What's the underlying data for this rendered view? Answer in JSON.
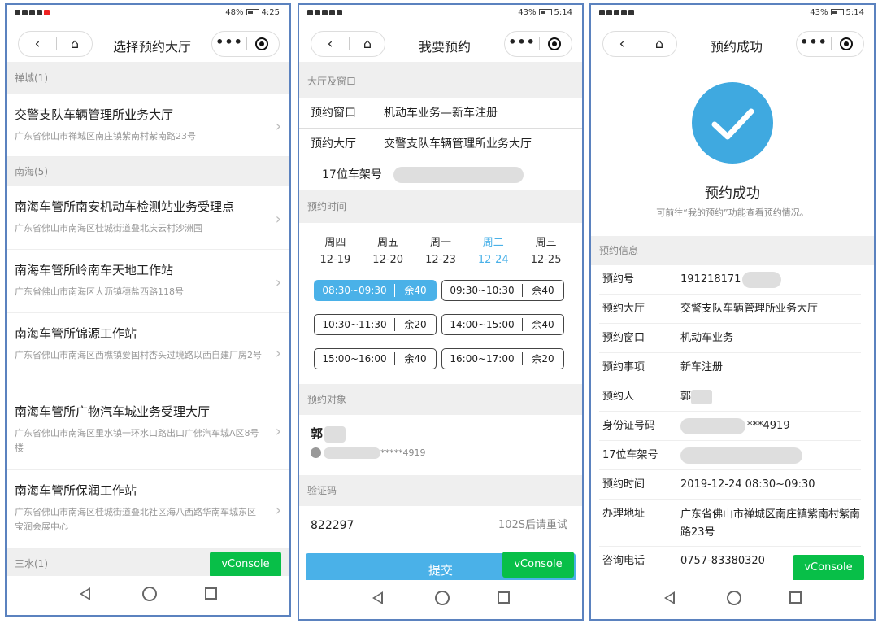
{
  "status": {
    "p1": {
      "battery": "48%",
      "time": "4:25"
    },
    "p2": {
      "battery": "43%",
      "time": "5:14"
    },
    "p3": {
      "battery": "43%",
      "time": "5:14"
    }
  },
  "nav": {
    "back_icon": "‹",
    "home_icon": "⌂",
    "more_icon": "•••",
    "p1_title": "选择预约大厅",
    "p2_title": "我要预约",
    "p3_title": "预约成功"
  },
  "vconsole_label": "vConsole",
  "halls": {
    "groups": [
      {
        "header": "禅城(1)",
        "items": [
          {
            "name": "交警支队车辆管理所业务大厅",
            "addr": "广东省佛山市禅城区南庄镇紫南村紫南路23号"
          }
        ]
      },
      {
        "header": "南海(5)",
        "items": [
          {
            "name": "南海车管所南安机动车检测站业务受理点",
            "addr": "广东省佛山市南海区桂城街道叠北庆云村沙洲围"
          },
          {
            "name": "南海车管所岭南车天地工作站",
            "addr": "广东省佛山市南海区大沥镇穗盐西路118号"
          },
          {
            "name": "南海车管所锦源工作站",
            "addr": "广东省佛山市南海区西樵镇爱国村杏头过境路以西自建厂房2号"
          },
          {
            "name": "南海车管所广物汽车城业务受理大厅",
            "addr": "广东省佛山市南海区里水镇一环水口路出口广佛汽车城A区8号楼"
          },
          {
            "name": "南海车管所保润工作站",
            "addr": "广东省佛山市南海区桂城街道叠北社区海八西路华南车城东区宝润会展中心"
          }
        ]
      },
      {
        "header": "三水(1)",
        "items": []
      }
    ]
  },
  "booking": {
    "section_hall": "大厅及窗口",
    "window_label": "预约窗口",
    "window_value": "机动车业务—新车注册",
    "hall_label": "预约大厅",
    "hall_value": "交警支队车辆管理所业务大厅",
    "vin_label": "17位车架号",
    "section_time": "预约时间",
    "days": [
      {
        "weekday": "周四",
        "date": "12-19",
        "selected": false
      },
      {
        "weekday": "周五",
        "date": "12-20",
        "selected": false
      },
      {
        "weekday": "周一",
        "date": "12-23",
        "selected": false
      },
      {
        "weekday": "周二",
        "date": "12-24",
        "selected": true
      },
      {
        "weekday": "周三",
        "date": "12-25",
        "selected": false
      }
    ],
    "slots": [
      {
        "time": "08:30~09:30",
        "count": "余40",
        "active": true
      },
      {
        "time": "09:30~10:30",
        "count": "余40",
        "active": false
      },
      {
        "time": "10:30~11:30",
        "count": "余20",
        "active": false
      },
      {
        "time": "14:00~15:00",
        "count": "余40",
        "active": false
      },
      {
        "time": "15:00~16:00",
        "count": "余40",
        "active": false
      },
      {
        "time": "16:00~17:00",
        "count": "余20",
        "active": false
      }
    ],
    "section_target": "预约对象",
    "person_name": "郭",
    "person_id": "*****4919",
    "section_code": "验证码",
    "code_value": "822297",
    "retry_text": "102S后请重试",
    "submit_label": "提交"
  },
  "success": {
    "title": "预约成功",
    "subtitle": "可前往“我的预约”功能查看预约情况。",
    "section_info": "预约信息",
    "rows": [
      {
        "label": "预约号",
        "value": "191218171"
      },
      {
        "label": "预约大厅",
        "value": "交警支队车辆管理所业务大厅"
      },
      {
        "label": "预约窗口",
        "value": "机动车业务"
      },
      {
        "label": "预约事项",
        "value": "新车注册"
      },
      {
        "label": "预约人",
        "value": "郭"
      },
      {
        "label": "身份证号码",
        "value": "***4919"
      },
      {
        "label": "17位车架号",
        "value": ""
      },
      {
        "label": "预约时间",
        "value": "2019-12-24 08:30~09:30"
      },
      {
        "label": "办理地址",
        "value": "广东省佛山市禅城区南庄镇紫南村紫南路23号"
      },
      {
        "label": "咨询电话",
        "value": "0757-83380320"
      }
    ]
  }
}
